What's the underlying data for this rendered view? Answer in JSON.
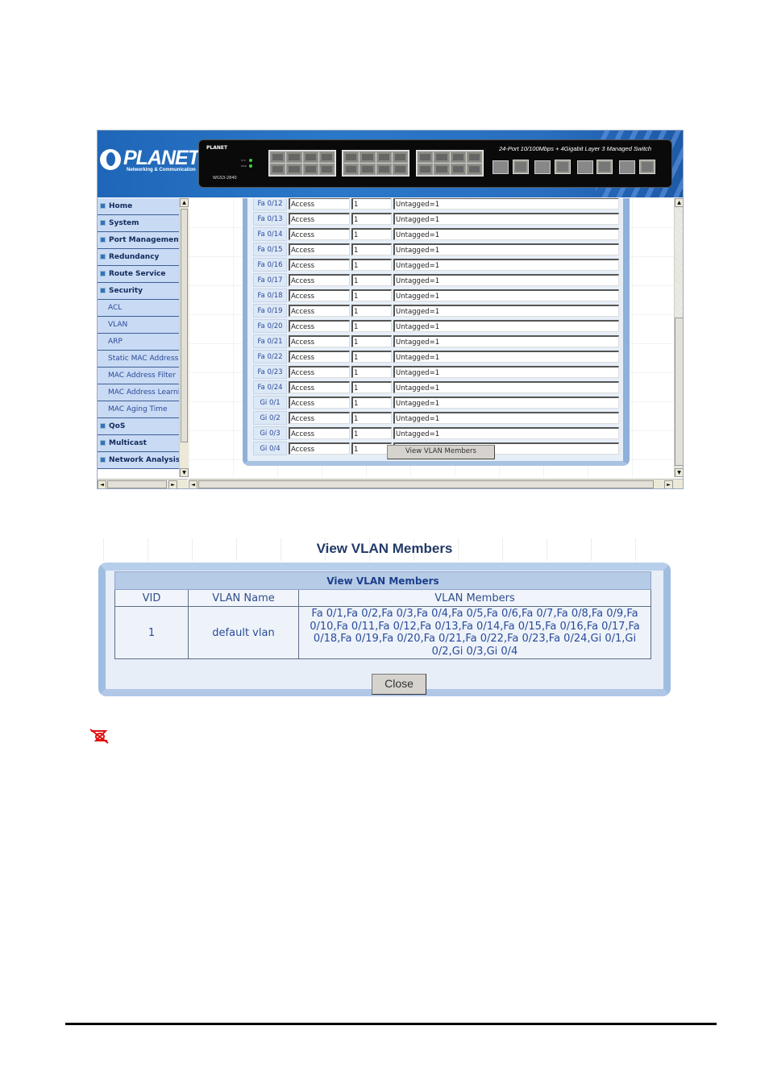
{
  "screenshot1": {
    "logo": {
      "name": "PLANET",
      "tagline": "Networking & Communication"
    },
    "device": {
      "brand": "PLANET",
      "model": "WGS3-2840",
      "title": "24-Port 10/100Mbps + 4Gigabit Layer 3 Managed Switch",
      "led_labels": [
        "SYS",
        "PWR"
      ]
    },
    "sidebar": {
      "items": [
        {
          "label": "Home",
          "type": "parent"
        },
        {
          "label": "System",
          "type": "parent"
        },
        {
          "label": "Port Management",
          "type": "parent"
        },
        {
          "label": "Redundancy",
          "type": "parent"
        },
        {
          "label": "Route Service",
          "type": "parent"
        },
        {
          "label": "Security",
          "type": "parent"
        },
        {
          "label": "ACL",
          "type": "child"
        },
        {
          "label": "VLAN",
          "type": "child"
        },
        {
          "label": "ARP",
          "type": "child"
        },
        {
          "label": "Static MAC Address",
          "type": "child"
        },
        {
          "label": "MAC Address Filter",
          "type": "child"
        },
        {
          "label": "MAC Address Learning",
          "type": "child"
        },
        {
          "label": "MAC Aging Time",
          "type": "child"
        },
        {
          "label": "QoS",
          "type": "parent"
        },
        {
          "label": "Multicast",
          "type": "parent"
        },
        {
          "label": "Network Analysis",
          "type": "parent"
        }
      ]
    },
    "port_table": {
      "rows": [
        {
          "port": "Fa 0/12",
          "mode": "Access",
          "pvid": "1",
          "members": "Untagged=1"
        },
        {
          "port": "Fa 0/13",
          "mode": "Access",
          "pvid": "1",
          "members": "Untagged=1"
        },
        {
          "port": "Fa 0/14",
          "mode": "Access",
          "pvid": "1",
          "members": "Untagged=1"
        },
        {
          "port": "Fa 0/15",
          "mode": "Access",
          "pvid": "1",
          "members": "Untagged=1"
        },
        {
          "port": "Fa 0/16",
          "mode": "Access",
          "pvid": "1",
          "members": "Untagged=1"
        },
        {
          "port": "Fa 0/17",
          "mode": "Access",
          "pvid": "1",
          "members": "Untagged=1"
        },
        {
          "port": "Fa 0/18",
          "mode": "Access",
          "pvid": "1",
          "members": "Untagged=1"
        },
        {
          "port": "Fa 0/19",
          "mode": "Access",
          "pvid": "1",
          "members": "Untagged=1"
        },
        {
          "port": "Fa 0/20",
          "mode": "Access",
          "pvid": "1",
          "members": "Untagged=1"
        },
        {
          "port": "Fa 0/21",
          "mode": "Access",
          "pvid": "1",
          "members": "Untagged=1"
        },
        {
          "port": "Fa 0/22",
          "mode": "Access",
          "pvid": "1",
          "members": "Untagged=1"
        },
        {
          "port": "Fa 0/23",
          "mode": "Access",
          "pvid": "1",
          "members": "Untagged=1"
        },
        {
          "port": "Fa 0/24",
          "mode": "Access",
          "pvid": "1",
          "members": "Untagged=1"
        },
        {
          "port": "Gi 0/1",
          "mode": "Access",
          "pvid": "1",
          "members": "Untagged=1"
        },
        {
          "port": "Gi 0/2",
          "mode": "Access",
          "pvid": "1",
          "members": "Untagged=1"
        },
        {
          "port": "Gi 0/3",
          "mode": "Access",
          "pvid": "1",
          "members": "Untagged=1"
        },
        {
          "port": "Gi 0/4",
          "mode": "Access",
          "pvid": "1",
          "members": "Untagged=1"
        }
      ],
      "view_members_button": "View VLAN Members"
    },
    "scroll_arrows": {
      "up": "▲",
      "down": "▼",
      "left": "◄",
      "right": "►"
    }
  },
  "screenshot2": {
    "page_title": "View VLAN Members",
    "table_caption": "View VLAN Members",
    "columns": [
      "VID",
      "VLAN Name",
      "VLAN Members"
    ],
    "rows": [
      {
        "vid": "1",
        "name": "default vlan",
        "members": "Fa 0/1,Fa 0/2,Fa 0/3,Fa 0/4,Fa 0/5,Fa 0/6,Fa 0/7,Fa 0/8,Fa 0/9,Fa 0/10,Fa 0/11,Fa 0/12,Fa 0/13,Fa 0/14,Fa 0/15,Fa 0/16,Fa 0/17,Fa 0/18,Fa 0/19,Fa 0/20,Fa 0/21,Fa 0/22,Fa 0/23,Fa 0/24,Gi 0/1,Gi 0/2,Gi 0/3,Gi 0/4"
      }
    ],
    "close_button": "Close"
  },
  "note": {
    "icon": "note-hand-writing-icon",
    "color": "#e01010"
  },
  "colors": {
    "accent": "#1f66b8",
    "nav_bg": "#c9daf4",
    "link_text": "#2a4b9a"
  }
}
